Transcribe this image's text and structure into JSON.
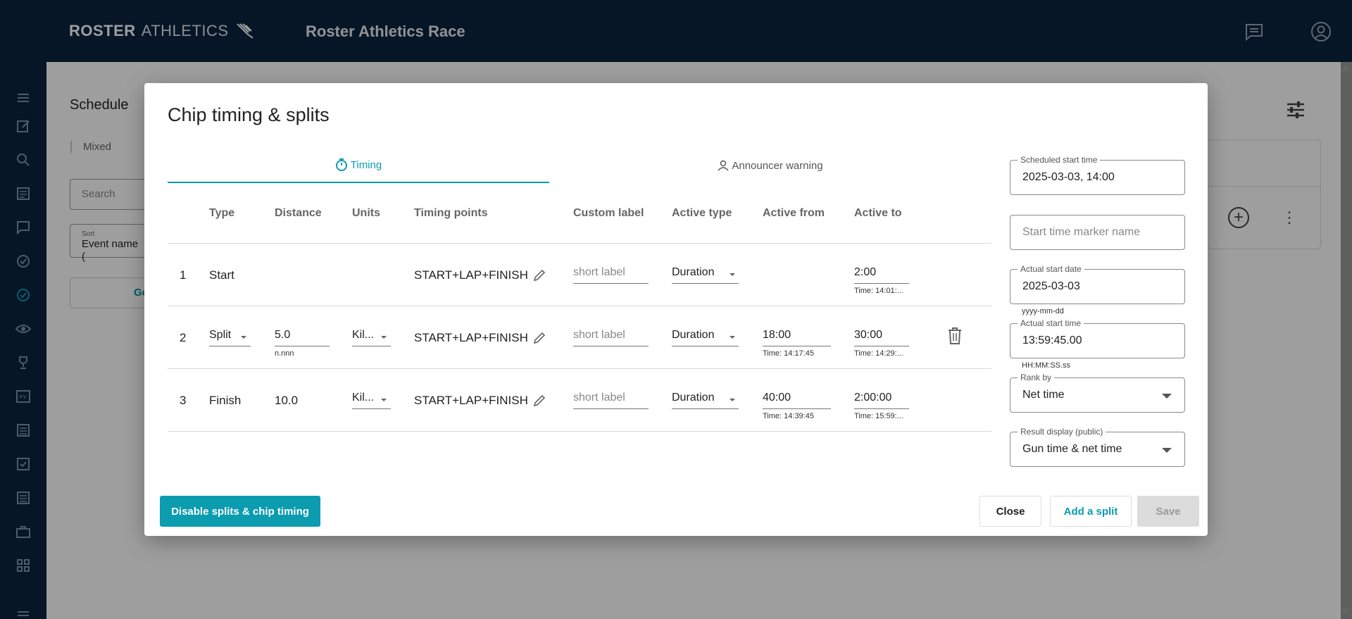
{
  "header": {
    "brand_bold": "ROSTER",
    "brand_thin": "ATHLETICS",
    "app_title": "Roster Athletics Race"
  },
  "background": {
    "schedule_title": "Schedule",
    "mixed_label": "Mixed",
    "search_placeholder": "Search",
    "sort_label": "Sort",
    "sort_value": "Event name (",
    "ge_button": "Ge"
  },
  "modal": {
    "title": "Chip timing & splits",
    "tabs": [
      {
        "label": "Timing",
        "active": true,
        "icon": "stopwatch-icon"
      },
      {
        "label": "Announcer warning",
        "active": false,
        "icon": "person-icon"
      }
    ],
    "columns": [
      "Type",
      "Distance",
      "Units",
      "Timing points",
      "Custom label",
      "Active type",
      "Active from",
      "Active to"
    ],
    "rows": [
      {
        "num": "1",
        "type": "Start",
        "distance": "",
        "distance_hint": "",
        "units": "",
        "timing_points": "START+LAP+FINISH",
        "custom_label_placeholder": "short label",
        "active_type": "Duration",
        "active_from": "",
        "active_from_time": "",
        "active_to": "2:00",
        "active_to_time": "Time: 14:01:..."
      },
      {
        "num": "2",
        "type": "Split",
        "distance": "5.0",
        "distance_hint": "n.nnn",
        "units": "Kil...",
        "timing_points": "START+LAP+FINISH",
        "custom_label_placeholder": "short label",
        "active_type": "Duration",
        "active_from": "18:00",
        "active_from_time": "Time: 14:17:45",
        "active_to": "30:00",
        "active_to_time": "Time: 14:29:..."
      },
      {
        "num": "3",
        "type": "Finish",
        "distance": "10.0",
        "distance_hint": "",
        "units": "Kil...",
        "timing_points": "START+LAP+FINISH",
        "custom_label_placeholder": "short label",
        "active_type": "Duration",
        "active_from": "40:00",
        "active_from_time": "Time: 14:39:45",
        "active_to": "2:00:00",
        "active_to_time": "Time: 15:59:..."
      }
    ],
    "side": {
      "scheduled_start_label": "Scheduled start time",
      "scheduled_start_value": "2025-03-03, 14:00",
      "marker_placeholder": "Start time marker name",
      "actual_date_label": "Actual start date",
      "actual_date_value": "2025-03-03",
      "actual_date_hint": "yyyy-mm-dd",
      "actual_time_label": "Actual start time",
      "actual_time_value": "13:59:45.00",
      "actual_time_hint": "HH:MM:SS.ss",
      "rank_label": "Rank by",
      "rank_value": "Net time",
      "display_label": "Result display (public)",
      "display_value": "Gun time & net time"
    },
    "buttons": {
      "disable": "Disable splits & chip timing",
      "close": "Close",
      "add_split": "Add a split",
      "save": "Save"
    }
  },
  "colors": {
    "nav_bg": "#0b2440",
    "accent": "#0b9cb0"
  }
}
